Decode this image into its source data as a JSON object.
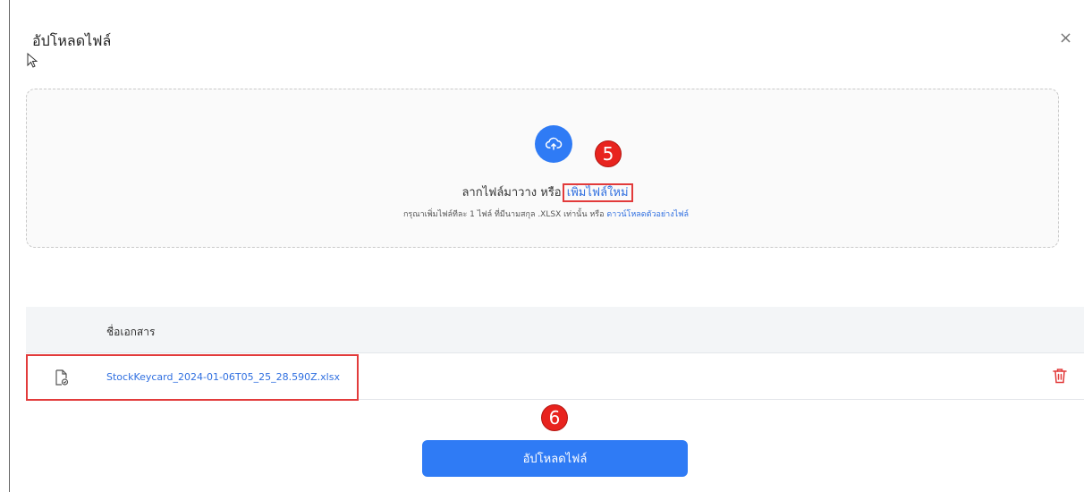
{
  "dialog": {
    "title": "อัปโหลดไฟล์",
    "close_glyph": "×"
  },
  "dropzone": {
    "text": "ลากไฟล์มาวาง หรือ ",
    "link": "เพิ่มไฟล์ใหม่",
    "hint_text": "กรุณาเพิ่มไฟล์ทีละ 1 ไฟล์ ที่มีนามสกุล .XLSX เท่านั้น หรือ ",
    "hint_link": "ดาวน์โหลดตัวอย่างไฟล์",
    "icon": "cloud-upload-icon"
  },
  "table": {
    "header": "ชื่อเอกสาร",
    "rows": [
      {
        "file_name": "StockKeycard_2024-01-06T05_25_28.590Z.xlsx",
        "icon": "file-icon",
        "action_icon": "trash-icon"
      }
    ]
  },
  "annotations": {
    "step5": "5",
    "step6": "6"
  },
  "submit": {
    "label": "อัปโหลดไฟล์"
  },
  "colors": {
    "primary": "#2f7bf5",
    "link": "#2f6fe0",
    "danger": "#e23b3b",
    "badge": "#e8231e"
  }
}
